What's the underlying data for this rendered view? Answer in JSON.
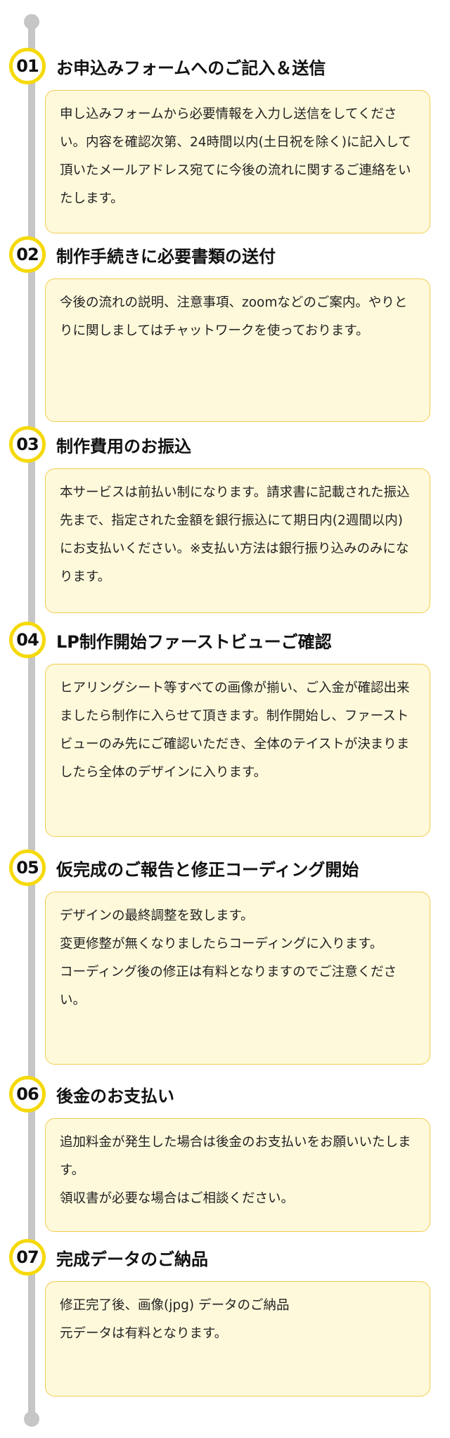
{
  "steps": [
    {
      "number": "01",
      "title": "お申込みフォームへのご記入＆送信",
      "body": "申し込みフォームから必要情報を入力し送信をしてください。内容を確認次第、24時間以内(土日祝を除く)に記入して頂いたメールアドレス宛てに今後の流れに関するご連絡をいたします。"
    },
    {
      "number": "02",
      "title": "制作手続きに必要書類の送付",
      "body": "今後の流れの説明、注意事項、zoomなどのご案内。やりとりに関しましてはチャットワークを使っております。"
    },
    {
      "number": "03",
      "title": "制作費用のお振込",
      "body": "本サービスは前払い制になります。請求書に記載された振込先まで、指定された金額を銀行振込にて期日内(2週間以内)にお支払いください。※支払い方法は銀行振り込みのみになります。"
    },
    {
      "number": "04",
      "title": "LP制作開始ファーストビューご確認",
      "body": "ヒアリングシート等すべての画像が揃い、ご入金が確認出来ましたら制作に入らせて頂きます。制作開始し、ファーストビューのみ先にご確認いただき、全体のテイストが決まりましたら全体のデザインに入ります。"
    },
    {
      "number": "05",
      "title": "仮完成のご報告と修正コーディング開始",
      "body": "デザインの最終調整を致します。\n変更修整が無くなりましたらコーディングに入ります。\nコーディング後の修正は有料となりますのでご注意ください。"
    },
    {
      "number": "06",
      "title": "後金のお支払い",
      "body": "追加料金が発生した場合は後金のお支払いをお願いいたします。\n領収書が必要な場合はご相談ください。"
    },
    {
      "number": "07",
      "title": "完成データのご納品",
      "body": "修正完了後、画像(jpg) データのご納品\n元データは有料となります。"
    }
  ],
  "colors": {
    "accent_yellow": "#f5d90a",
    "box_background": "#fef9db",
    "box_border": "#f2cd4f",
    "timeline": "#c6c6c6"
  }
}
